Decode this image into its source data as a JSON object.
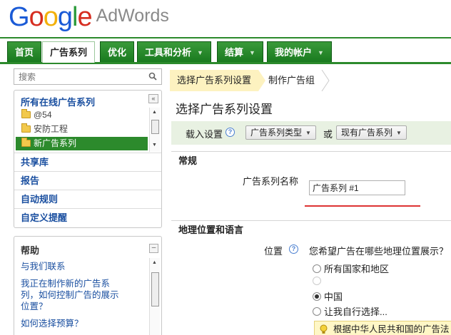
{
  "brand": {
    "logo_letters": [
      "G",
      "o",
      "o",
      "g",
      "l",
      "e"
    ],
    "product": "AdWords"
  },
  "nav": {
    "tabs": [
      {
        "label": "首页",
        "active": false,
        "has_menu": false
      },
      {
        "label": "广告系列",
        "active": true,
        "has_menu": false
      },
      {
        "label": "优化",
        "active": false,
        "has_menu": false
      },
      {
        "label": "工具和分析",
        "active": false,
        "has_menu": true
      },
      {
        "label": "结算",
        "active": false,
        "has_menu": true
      },
      {
        "label": "我的帐户",
        "active": false,
        "has_menu": true
      }
    ]
  },
  "sidebar": {
    "search_placeholder": "搜索",
    "all_campaigns": "所有在线广告系列",
    "collapse_symbol": "«",
    "tree": [
      {
        "label": "@54",
        "selected": false
      },
      {
        "label": "安防工程",
        "selected": false
      },
      {
        "label": "新广告系列",
        "selected": true
      }
    ],
    "links": [
      "共享库",
      "报告",
      "自动规则",
      "自定义提醒"
    ],
    "help": {
      "title": "帮助",
      "min_symbol": "–",
      "links": [
        "与我们联系",
        "我正在制作新的广告系列，如何控制广告的展示位置？",
        "如何选择预算？"
      ]
    }
  },
  "main": {
    "steps": [
      "选择广告系列设置",
      "制作广告组"
    ],
    "title": "选择广告系列设置",
    "load": {
      "label": "载入设置",
      "dropdown1": "广告系列类型",
      "or": "或",
      "dropdown2": "现有广告系列"
    },
    "general": {
      "heading": "常规",
      "name_label": "广告系列名称",
      "name_value": "广告系列 #1"
    },
    "geo": {
      "heading": "地理位置和语言",
      "location_label": "位置",
      "question": "您希望广告在哪些地理位置展示？",
      "options": [
        {
          "label": "所有国家和地区",
          "checked": false
        },
        {
          "label": "",
          "checked": false
        },
        {
          "label": "中国",
          "checked": true
        },
        {
          "label": "让我自行选择...",
          "checked": false
        }
      ],
      "notice": "根据中华人民共和国的广告法"
    }
  },
  "colors": {
    "nav_green": "#2c8a2c",
    "link_blue": "#1a4fa0",
    "step_yellow": "#fdf2c0",
    "load_bar_green": "#e8f1e2",
    "error_red": "#dd3333"
  }
}
